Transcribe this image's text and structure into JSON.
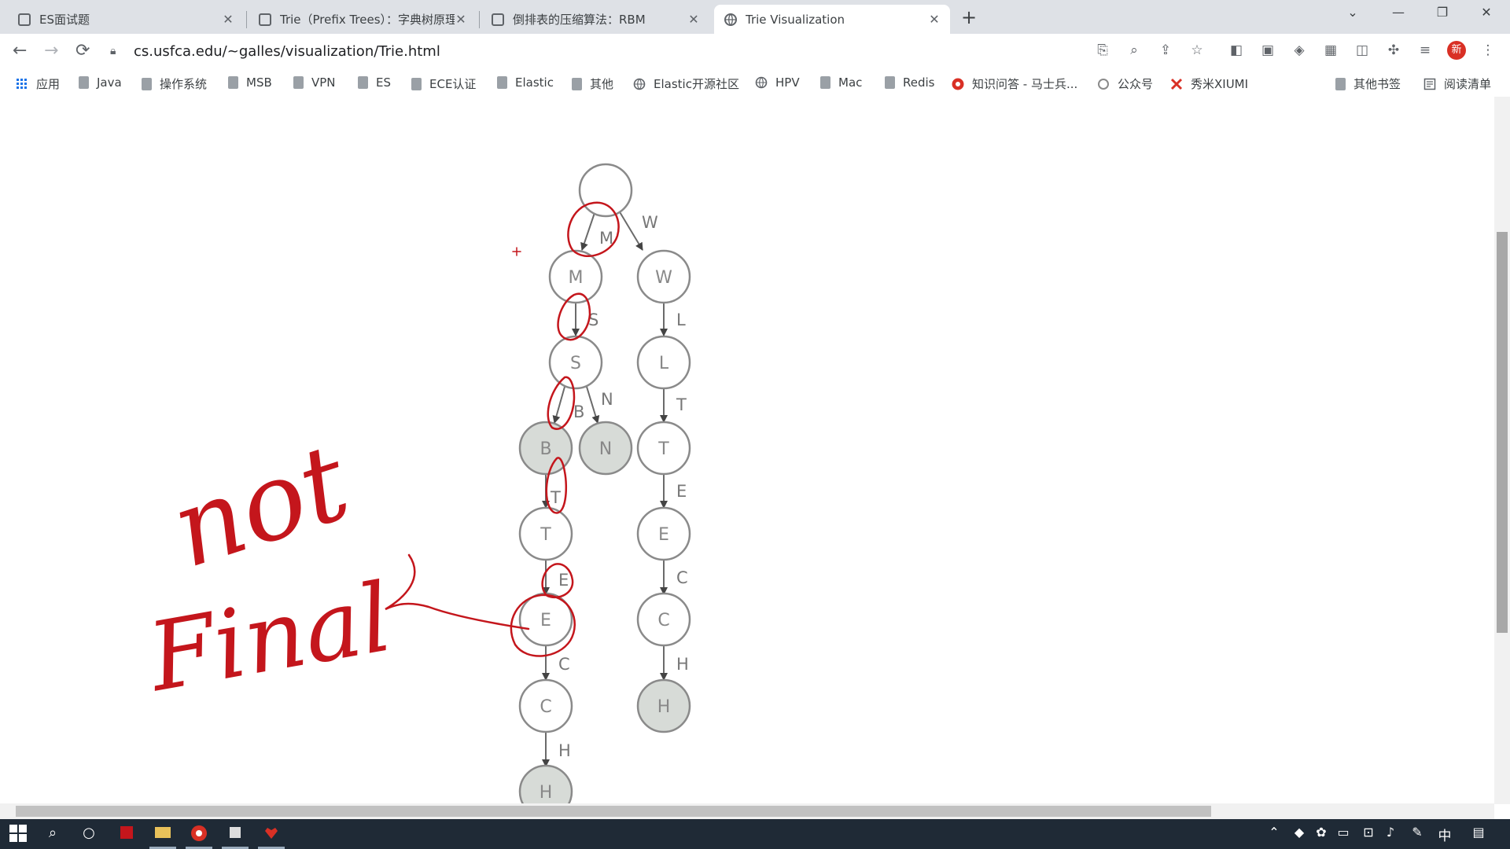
{
  "tabs": [
    {
      "title": "ES面试题",
      "close": "✕"
    },
    {
      "title": "Trie（Prefix Trees）：字典树原理",
      "close": "✕"
    },
    {
      "title": "倒排表的压缩算法：RBM",
      "close": "✕"
    },
    {
      "title": "Trie Visualization",
      "close": "✕"
    }
  ],
  "window": {
    "new_tab": "+",
    "chevron": "⌄",
    "minimize": "—",
    "restore": "❐",
    "close": "✕"
  },
  "toolbar": {
    "back": "←",
    "forward": "→",
    "reload": "⟳",
    "url": "cs.usfca.edu/~galles/visualization/Trie.html",
    "profile_letter": "新"
  },
  "bookmarks": [
    {
      "label": "应用",
      "icon": "apps-icon"
    },
    {
      "label": "Java",
      "icon": "folder-icon"
    },
    {
      "label": "操作系统",
      "icon": "folder-icon"
    },
    {
      "label": "MSB",
      "icon": "folder-icon"
    },
    {
      "label": "VPN",
      "icon": "folder-icon"
    },
    {
      "label": "ES",
      "icon": "folder-icon"
    },
    {
      "label": "ECE认证",
      "icon": "folder-icon"
    },
    {
      "label": "Elastic",
      "icon": "folder-icon"
    },
    {
      "label": "其他",
      "icon": "folder-icon"
    },
    {
      "label": "Elastic开源社区",
      "icon": "globe-icon"
    },
    {
      "label": "HPV",
      "icon": "globe-icon"
    },
    {
      "label": "Mac",
      "icon": "folder-icon"
    },
    {
      "label": "Redis",
      "icon": "folder-icon"
    },
    {
      "label": "知识问答 - 马士兵...",
      "icon": "site-icon"
    },
    {
      "label": "公众号",
      "icon": "site-icon"
    },
    {
      "label": "秀米XIUMI",
      "icon": "site-icon"
    },
    {
      "label": "其他书签",
      "icon": "folder-icon"
    },
    {
      "label": "阅读清单",
      "icon": "reading-list-icon"
    }
  ],
  "trie": {
    "root": "",
    "edges": {
      "root_m": "M",
      "root_w": "W",
      "m_s": "S",
      "s_b": "B",
      "s_n": "N",
      "b_t": "T",
      "t_e": "E",
      "e_c": "C",
      "c_h": "H",
      "w_l": "L",
      "l_t": "T",
      "t2_e": "E",
      "e2_c": "C",
      "c2_h": "H"
    },
    "nodes": {
      "m": "M",
      "s": "S",
      "b": "B",
      "n": "N",
      "t": "T",
      "e": "E",
      "c": "C",
      "h": "H",
      "w": "W",
      "l": "L",
      "t2": "T",
      "e2": "E",
      "c2": "C",
      "h2": "H"
    },
    "final_nodes": [
      "B",
      "N",
      "H (under W branch)",
      "H (under B branch)"
    ]
  },
  "annotation": {
    "line1": "not",
    "line2": "Final"
  },
  "taskbar": {
    "lang": "中"
  },
  "colors": {
    "annotation": "#c4161c",
    "final_fill": "#d7dbd7",
    "node_stroke": "#7b7b7b"
  }
}
